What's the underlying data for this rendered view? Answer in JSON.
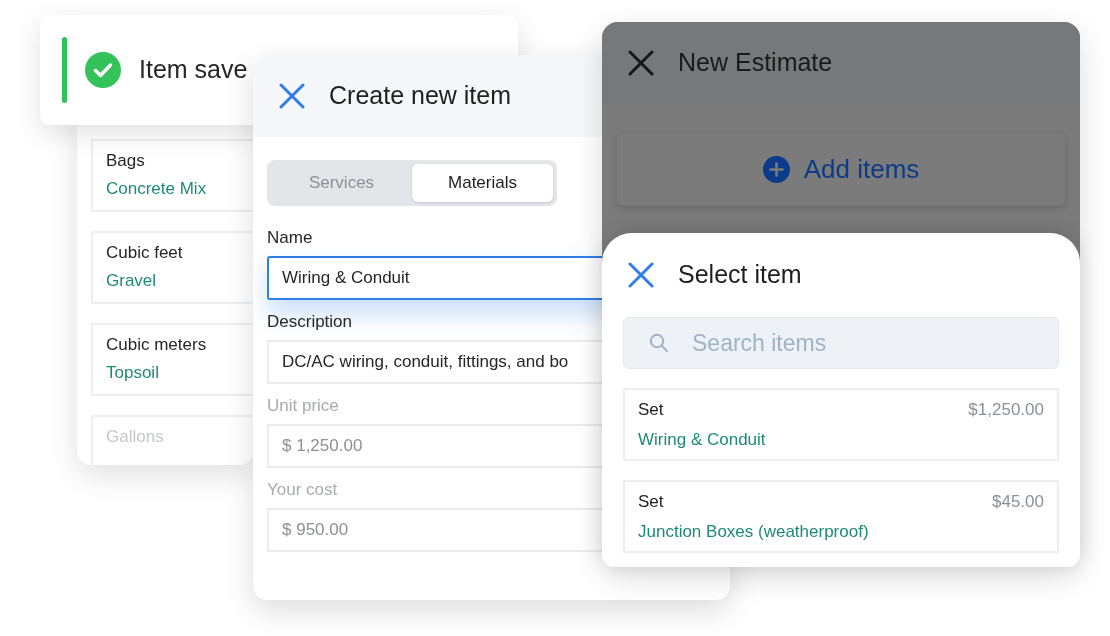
{
  "materials_list": {
    "items": [
      {
        "unit": "Bags",
        "name": "Concrete Mix",
        "faded": false
      },
      {
        "unit": "Cubic feet",
        "name": "Gravel",
        "faded": false
      },
      {
        "unit": "Cubic meters",
        "name": "Topsoil",
        "faded": false
      },
      {
        "unit": "Gallons",
        "faded": true
      }
    ]
  },
  "toast": {
    "message": "Item save"
  },
  "create_item": {
    "title": "Create new item",
    "tabs": [
      {
        "label": "Services",
        "selected": false
      },
      {
        "label": "Materials",
        "selected": true
      }
    ],
    "fields": [
      {
        "label": "Name",
        "value": "Wiring & Conduit",
        "focused": true,
        "disabled": false
      },
      {
        "label": "Description",
        "value": "DC/AC wiring, conduit, fittings, and bo",
        "focused": false,
        "disabled": false
      },
      {
        "label": "Unit price",
        "value": "$ 1,250.00",
        "focused": false,
        "disabled": true
      },
      {
        "label": "Your cost",
        "value": "$ 950.00",
        "focused": false,
        "disabled": true
      }
    ]
  },
  "new_estimate": {
    "title": "New Estimate",
    "add_button": "Add items"
  },
  "select_item": {
    "title": "Select item",
    "search": {
      "placeholder": "Search items"
    },
    "results": [
      {
        "type": "Set",
        "name": "Wiring & Conduit",
        "price": "$1,250.00"
      },
      {
        "type": "Set",
        "name": "Junction Boxes (weatherproof)",
        "price": "$45.00"
      }
    ]
  }
}
